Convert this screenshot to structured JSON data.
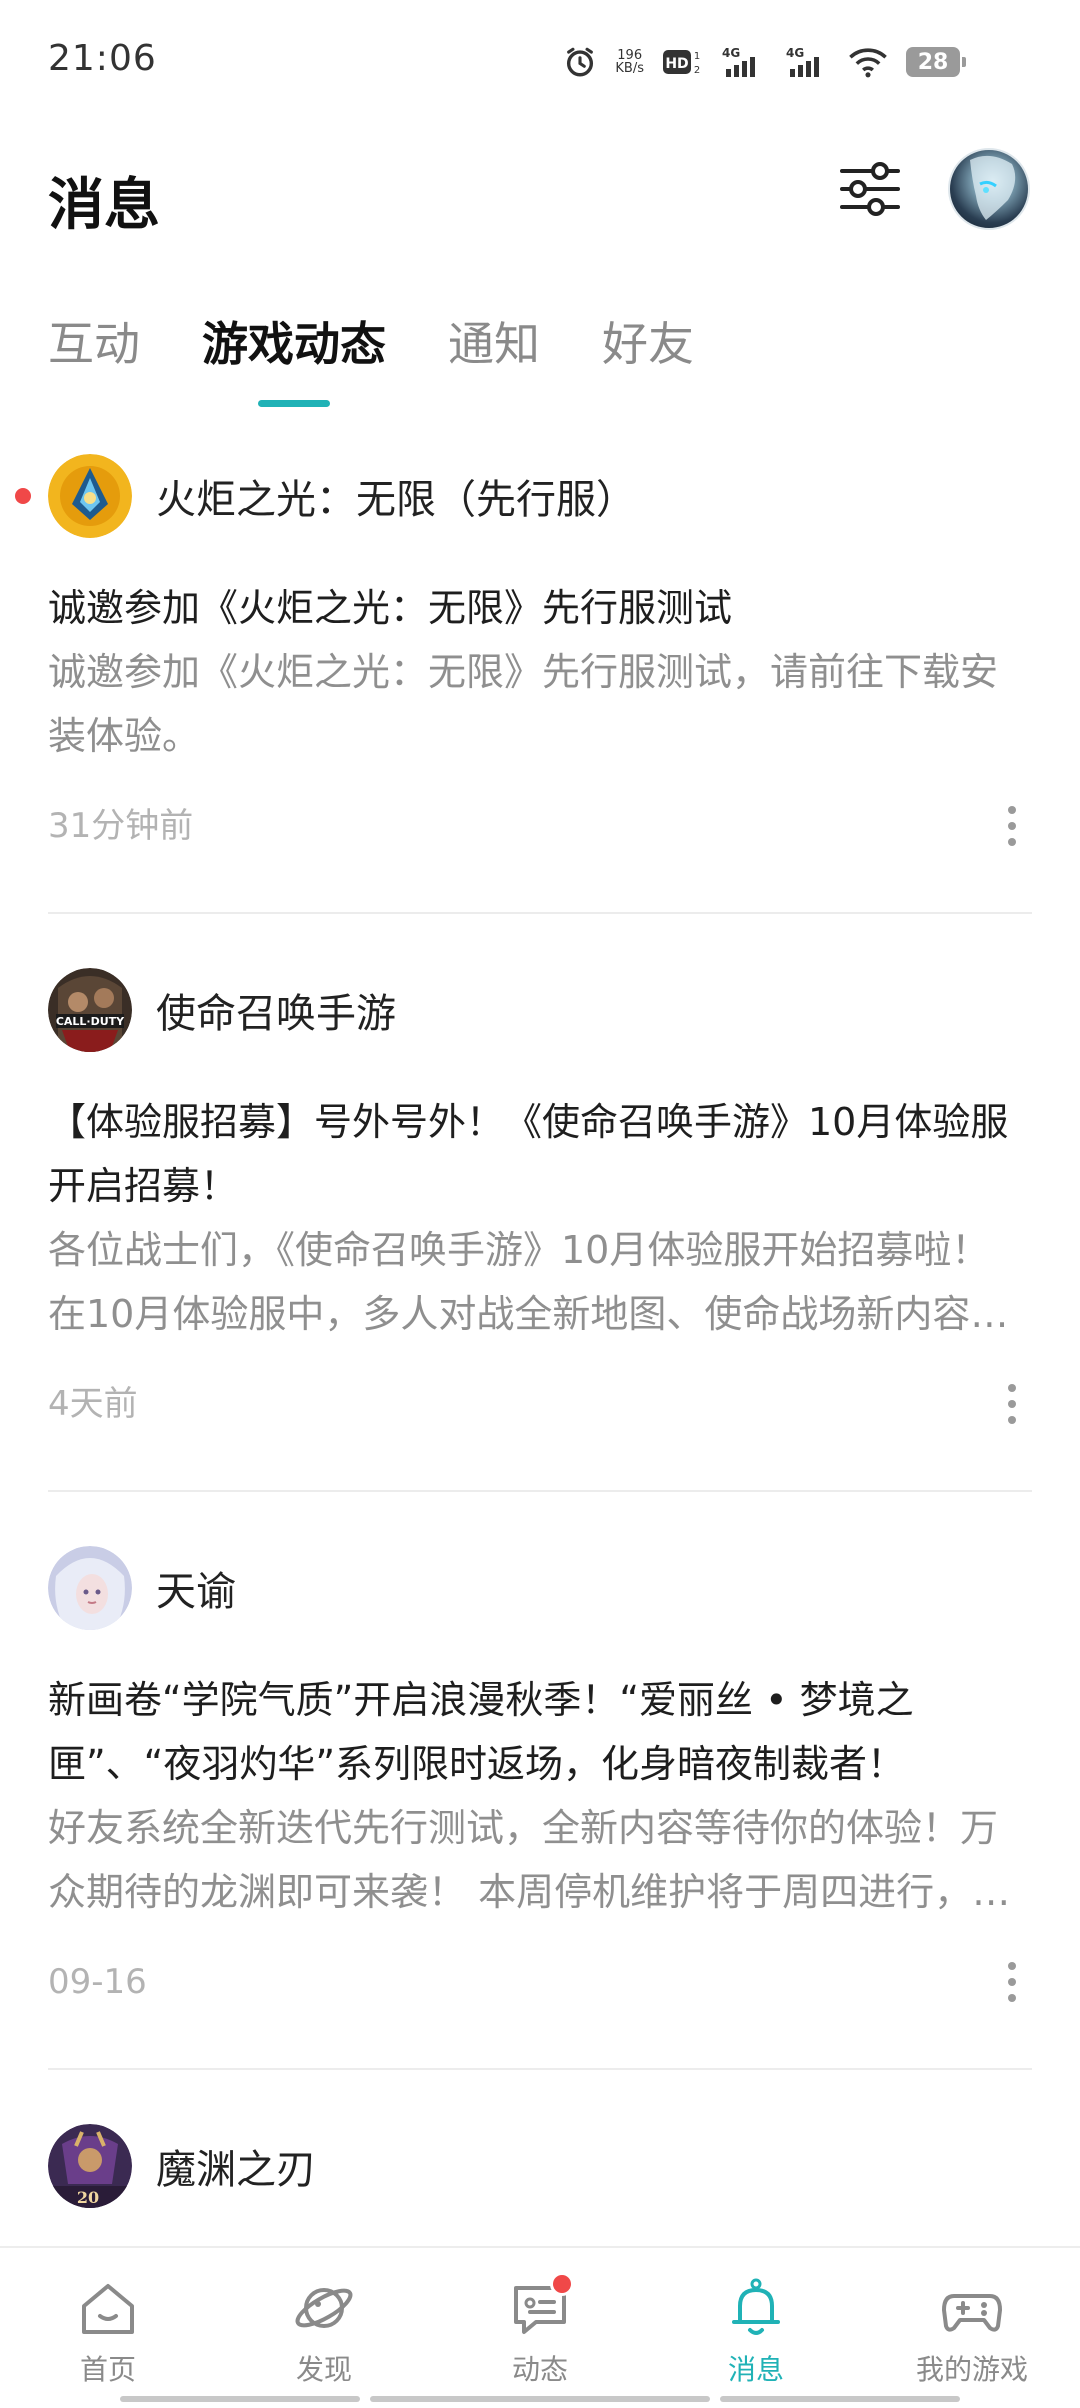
{
  "status_bar": {
    "time": "21:06",
    "speed_value": "196",
    "speed_unit": "KB/s",
    "battery": "28"
  },
  "header": {
    "title": "消息"
  },
  "tabs": [
    {
      "label": "互动",
      "active": false
    },
    {
      "label": "游戏动态",
      "active": true
    },
    {
      "label": "通知",
      "active": false
    },
    {
      "label": "好友",
      "active": false
    }
  ],
  "feed": [
    {
      "game": "火炬之光：无限（先行服）",
      "title": "诚邀参加《火炬之光：无限》先行服测试",
      "summary": "诚邀参加《火炬之光：无限》先行服测试，请前往下载安装体验。",
      "time": "31分钟前",
      "unread": true
    },
    {
      "game": "使命召唤手游",
      "title": "【体验服招募】号外号外！《使命召唤手游》10月体验服开启招募！",
      "summary": "各位战士们，《使命召唤手游》10月体验服开始招募啦！ 在10月体验服中，多人对战全新地图、使命战场新内容等你来体验！",
      "time": "4天前",
      "unread": false
    },
    {
      "game": "天谕",
      "title": "新画卷“学院气质”开启浪漫秋季！“爱丽丝 • 梦境之匣”、“夜羽灼华”系列限时返场，化身暗夜制裁者！",
      "summary": "好友系统全新迭代先行测试，全新内容等待你的体验！万众期待的龙渊即可来袭！ 本周停机维护将于周四进行，请各位玩家注意！",
      "time": "09-16",
      "unread": false
    },
    {
      "game": "魔渊之刃",
      "title": "",
      "summary": "",
      "time": "",
      "unread": false
    }
  ],
  "bottom_nav": [
    {
      "label": "首页",
      "icon": "home-icon"
    },
    {
      "label": "发现",
      "icon": "discover-planet-icon"
    },
    {
      "label": "动态",
      "icon": "feed-chat-icon",
      "badge": true
    },
    {
      "label": "消息",
      "icon": "bell-icon",
      "active": true
    },
    {
      "label": "我的游戏",
      "icon": "gamepad-icon"
    }
  ],
  "colors": {
    "accent": "#20b2b6",
    "badge": "#f04848",
    "muted_text": "#8f8f8f"
  }
}
